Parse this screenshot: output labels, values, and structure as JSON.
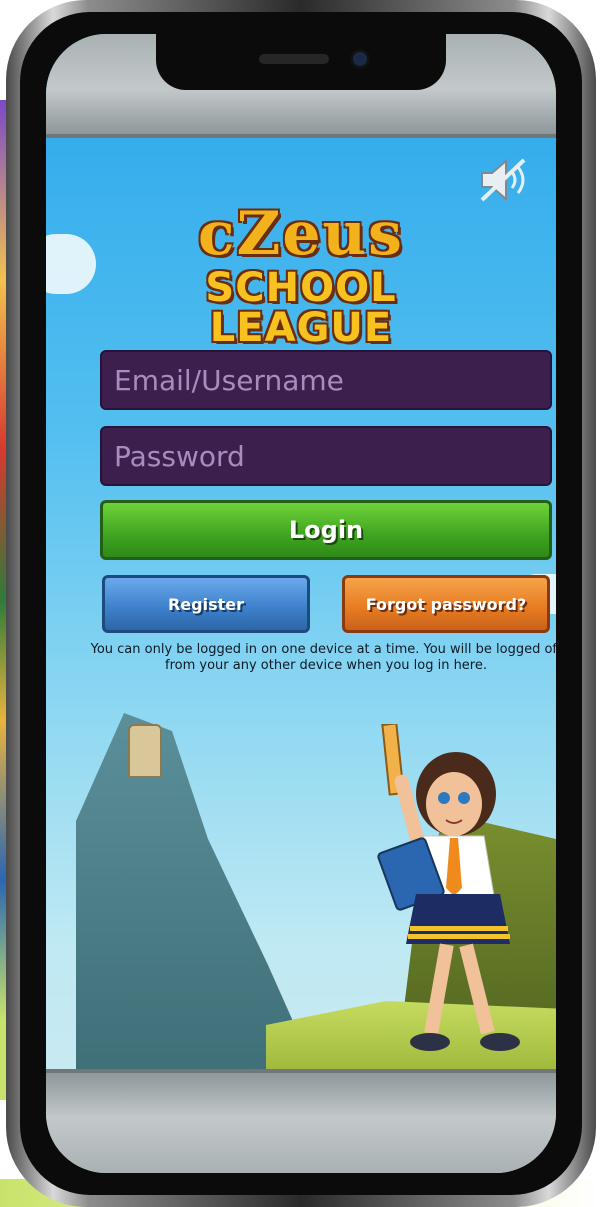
{
  "app": {
    "logo_top": "cZeus",
    "logo_bottom": "SCHOOL LEAGUE"
  },
  "login_form": {
    "email_placeholder": "Email/Username",
    "password_placeholder": "Password",
    "login_label": "Login",
    "register_label": "Register",
    "forgot_label": "Forgot password?",
    "notice": "You can only be logged in on one device at a time. You will be logged off from your any other device when you log in here."
  },
  "icons": {
    "sound": "speaker-muted-icon"
  },
  "colors": {
    "input_bg": "#3d1f4e",
    "login_green": "#3fa421",
    "register_blue": "#3c7fc9",
    "forgot_orange": "#e67a21",
    "sky": "#2ba7ea"
  }
}
